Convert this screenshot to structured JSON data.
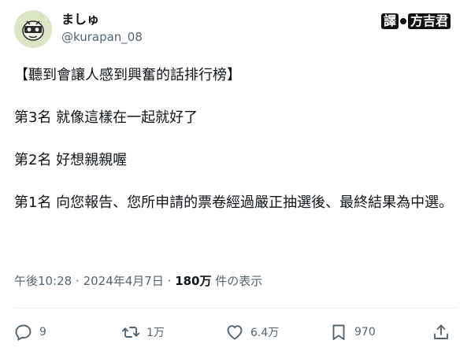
{
  "author": {
    "display_name": "ましゅ",
    "handle": "@kurapan_08",
    "avatar_icon": "mascot-avatar-icon"
  },
  "watermark": {
    "left": "譯",
    "right": "方吉君"
  },
  "tweet": {
    "line1": "【聽到會讓人感到興奮的話排行榜】",
    "line2": "第3名 就像這樣在一起就好了",
    "line3": "第2名 好想親親喔",
    "line4": "第1名 向您報告、您所申請的票卷經過嚴正抽選後、最終結果為中選。"
  },
  "meta": {
    "time": "午後10:28",
    "date": "2024年4月7日",
    "views": "180万",
    "views_label": "件の表示",
    "separator": "·"
  },
  "actions": {
    "reply_count": "9",
    "retweet_count": "1万",
    "like_count": "6.4万",
    "bookmark_count": "970"
  },
  "colors": {
    "text": "#0f1419",
    "secondary": "#536471",
    "divider": "#eff3f4"
  }
}
